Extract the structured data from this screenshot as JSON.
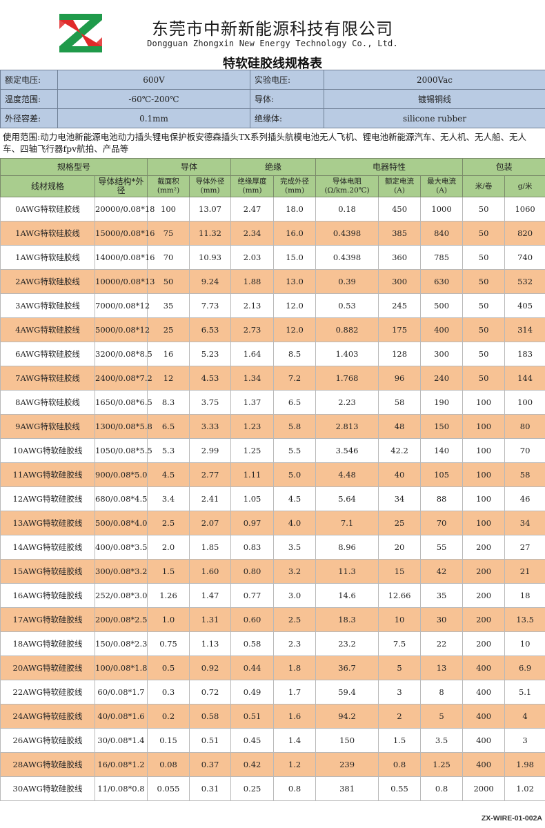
{
  "company": {
    "name_cn": "东莞市中新新能源科技有限公司",
    "name_en": "Dongguan Zhongxin New Energy Technology Co., Ltd.",
    "logo_icon": "zx-logo-icon"
  },
  "doc_title": "特软硅胶线规格表",
  "info": {
    "rated_voltage_label": "额定电压:",
    "rated_voltage_value": "600V",
    "test_voltage_label": "实验电压:",
    "test_voltage_value": "2000Vac",
    "temp_range_label": "温度范围:",
    "temp_range_value": "-60℃-200℃",
    "conductor_label": "导体:",
    "conductor_value": "镀锡铜线",
    "od_tolerance_label": "外径容差:",
    "od_tolerance_value": "0.1mm",
    "insulation_label": "绝缘体:",
    "insulation_value": "silicone rubber"
  },
  "usage": "使用范围:动力电池新能源电池动力插头锂电保护板安德森插头TX系列插头航模电池无人飞机、锂电池新能源汽车、无人机、无人船、无人车、四轴飞行器fpv航拍、产品等",
  "table": {
    "group_headers": {
      "model": "规格型号",
      "conductor": "导体",
      "insulation": "绝缘",
      "electrical": "电器特性",
      "packing": "包装"
    },
    "columns": {
      "spec": "线材规格",
      "structure": "导体结构*外径",
      "area_line1": "截面积",
      "area_line2": "(mm²)",
      "cond_od_line1": "导体外径",
      "cond_od_line2": "(mm)",
      "ins_thick_line1": "绝缘厚度",
      "ins_thick_line2": "(mm)",
      "finish_od_line1": "完成外径",
      "finish_od_line2": "(mm)",
      "resist_line1": "导体电阻",
      "resist_line2": "(Ω/km.20℃)",
      "rated_cur_line1": "额定电流",
      "rated_cur_line2": "(A)",
      "max_cur_line1": "最大电流",
      "max_cur_line2": "(A)",
      "m_per_roll": "米/卷",
      "g_per_m": "g/米"
    },
    "rows": [
      {
        "spec": "0AWG特软硅胶线",
        "structure": "20000/0.08*18",
        "area": "100",
        "cond_od": "13.07",
        "ins_thick": "2.47",
        "finish_od": "18.0",
        "resist": "0.18",
        "rated": "450",
        "max": "1000",
        "m_roll": "50",
        "g_m": "1060"
      },
      {
        "spec": "1AWG特软硅胶线",
        "structure": "15000/0.08*16",
        "area": "75",
        "cond_od": "11.32",
        "ins_thick": "2.34",
        "finish_od": "16.0",
        "resist": "0.4398",
        "rated": "385",
        "max": "840",
        "m_roll": "50",
        "g_m": "820"
      },
      {
        "spec": "1AWG特软硅胶线",
        "structure": "14000/0.08*16",
        "area": "70",
        "cond_od": "10.93",
        "ins_thick": "2.03",
        "finish_od": "15.0",
        "resist": "0.4398",
        "rated": "360",
        "max": "785",
        "m_roll": "50",
        "g_m": "740"
      },
      {
        "spec": "2AWG特软硅胶线",
        "structure": "10000/0.08*13",
        "area": "50",
        "cond_od": "9.24",
        "ins_thick": "1.88",
        "finish_od": "13.0",
        "resist": "0.39",
        "rated": "300",
        "max": "630",
        "m_roll": "50",
        "g_m": "532"
      },
      {
        "spec": "3AWG特软硅胶线",
        "structure": "7000/0.08*12",
        "area": "35",
        "cond_od": "7.73",
        "ins_thick": "2.13",
        "finish_od": "12.0",
        "resist": "0.53",
        "rated": "245",
        "max": "500",
        "m_roll": "50",
        "g_m": "405"
      },
      {
        "spec": "4AWG特软硅胶线",
        "structure": "5000/0.08*12",
        "area": "25",
        "cond_od": "6.53",
        "ins_thick": "2.73",
        "finish_od": "12.0",
        "resist": "0.882",
        "rated": "175",
        "max": "400",
        "m_roll": "50",
        "g_m": "314"
      },
      {
        "spec": "6AWG特软硅胶线",
        "structure": "3200/0.08*8.5",
        "area": "16",
        "cond_od": "5.23",
        "ins_thick": "1.64",
        "finish_od": "8.5",
        "resist": "1.403",
        "rated": "128",
        "max": "300",
        "m_roll": "50",
        "g_m": "183"
      },
      {
        "spec": "7AWG特软硅胶线",
        "structure": "2400/0.08*7.2",
        "area": "12",
        "cond_od": "4.53",
        "ins_thick": "1.34",
        "finish_od": "7.2",
        "resist": "1.768",
        "rated": "96",
        "max": "240",
        "m_roll": "50",
        "g_m": "144"
      },
      {
        "spec": "8AWG特软硅胶线",
        "structure": "1650/0.08*6.5",
        "area": "8.3",
        "cond_od": "3.75",
        "ins_thick": "1.37",
        "finish_od": "6.5",
        "resist": "2.23",
        "rated": "58",
        "max": "190",
        "m_roll": "100",
        "g_m": "100"
      },
      {
        "spec": "9AWG特软硅胶线",
        "structure": "1300/0.08*5.8",
        "area": "6.5",
        "cond_od": "3.33",
        "ins_thick": "1.23",
        "finish_od": "5.8",
        "resist": "2.813",
        "rated": "48",
        "max": "150",
        "m_roll": "100",
        "g_m": "80"
      },
      {
        "spec": "10AWG特软硅胶线",
        "structure": "1050/0.08*5.5",
        "area": "5.3",
        "cond_od": "2.99",
        "ins_thick": "1.25",
        "finish_od": "5.5",
        "resist": "3.546",
        "rated": "42.2",
        "max": "140",
        "m_roll": "100",
        "g_m": "70"
      },
      {
        "spec": "11AWG特软硅胶线",
        "structure": "900/0.08*5.0",
        "area": "4.5",
        "cond_od": "2.77",
        "ins_thick": "1.11",
        "finish_od": "5.0",
        "resist": "4.48",
        "rated": "40",
        "max": "105",
        "m_roll": "100",
        "g_m": "58"
      },
      {
        "spec": "12AWG特软硅胶线",
        "structure": "680/0.08*4.5",
        "area": "3.4",
        "cond_od": "2.41",
        "ins_thick": "1.05",
        "finish_od": "4.5",
        "resist": "5.64",
        "rated": "34",
        "max": "88",
        "m_roll": "100",
        "g_m": "46"
      },
      {
        "spec": "13AWG特软硅胶线",
        "structure": "500/0.08*4.0",
        "area": "2.5",
        "cond_od": "2.07",
        "ins_thick": "0.97",
        "finish_od": "4.0",
        "resist": "7.1",
        "rated": "25",
        "max": "70",
        "m_roll": "100",
        "g_m": "34"
      },
      {
        "spec": "14AWG特软硅胶线",
        "structure": "400/0.08*3.5",
        "area": "2.0",
        "cond_od": "1.85",
        "ins_thick": "0.83",
        "finish_od": "3.5",
        "resist": "8.96",
        "rated": "20",
        "max": "55",
        "m_roll": "200",
        "g_m": "27"
      },
      {
        "spec": "15AWG特软硅胶线",
        "structure": "300/0.08*3.2",
        "area": "1.5",
        "cond_od": "1.60",
        "ins_thick": "0.80",
        "finish_od": "3.2",
        "resist": "11.3",
        "rated": "15",
        "max": "42",
        "m_roll": "200",
        "g_m": "21"
      },
      {
        "spec": "16AWG特软硅胶线",
        "structure": "252/0.08*3.0",
        "area": "1.26",
        "cond_od": "1.47",
        "ins_thick": "0.77",
        "finish_od": "3.0",
        "resist": "14.6",
        "rated": "12.66",
        "max": "35",
        "m_roll": "200",
        "g_m": "18"
      },
      {
        "spec": "17AWG特软硅胶线",
        "structure": "200/0.08*2.5",
        "area": "1.0",
        "cond_od": "1.31",
        "ins_thick": "0.60",
        "finish_od": "2.5",
        "resist": "18.3",
        "rated": "10",
        "max": "30",
        "m_roll": "200",
        "g_m": "13.5"
      },
      {
        "spec": "18AWG特软硅胶线",
        "structure": "150/0.08*2.3",
        "area": "0.75",
        "cond_od": "1.13",
        "ins_thick": "0.58",
        "finish_od": "2.3",
        "resist": "23.2",
        "rated": "7.5",
        "max": "22",
        "m_roll": "200",
        "g_m": "10"
      },
      {
        "spec": "20AWG特软硅胶线",
        "structure": "100/0.08*1.8",
        "area": "0.5",
        "cond_od": "0.92",
        "ins_thick": "0.44",
        "finish_od": "1.8",
        "resist": "36.7",
        "rated": "5",
        "max": "13",
        "m_roll": "400",
        "g_m": "6.9"
      },
      {
        "spec": "22AWG特软硅胶线",
        "structure": "60/0.08*1.7",
        "area": "0.3",
        "cond_od": "0.72",
        "ins_thick": "0.49",
        "finish_od": "1.7",
        "resist": "59.4",
        "rated": "3",
        "max": "8",
        "m_roll": "400",
        "g_m": "5.1"
      },
      {
        "spec": "24AWG特软硅胶线",
        "structure": "40/0.08*1.6",
        "area": "0.2",
        "cond_od": "0.58",
        "ins_thick": "0.51",
        "finish_od": "1.6",
        "resist": "94.2",
        "rated": "2",
        "max": "5",
        "m_roll": "400",
        "g_m": "4"
      },
      {
        "spec": "26AWG特软硅胶线",
        "structure": "30/0.08*1.4",
        "area": "0.15",
        "cond_od": "0.51",
        "ins_thick": "0.45",
        "finish_od": "1.4",
        "resist": "150",
        "rated": "1.5",
        "max": "3.5",
        "m_roll": "400",
        "g_m": "3"
      },
      {
        "spec": "28AWG特软硅胶线",
        "structure": "16/0.08*1.2",
        "area": "0.08",
        "cond_od": "0.37",
        "ins_thick": "0.42",
        "finish_od": "1.2",
        "resist": "239",
        "rated": "0.8",
        "max": "1.25",
        "m_roll": "400",
        "g_m": "1.98"
      },
      {
        "spec": "30AWG特软硅胶线",
        "structure": "11/0.08*0.8",
        "area": "0.055",
        "cond_od": "0.31",
        "ins_thick": "0.25",
        "finish_od": "0.8",
        "resist": "381",
        "rated": "0.55",
        "max": "0.8",
        "m_roll": "2000",
        "g_m": "1.02"
      }
    ]
  },
  "footer_code": "ZX-WIRE-01-002A",
  "colors": {
    "info_bg": "#b9cbe3",
    "header_green": "#a9cd8e",
    "row_orange": "#f7c294",
    "logo_green": "#1f9a4a",
    "logo_red": "#e02a2a"
  }
}
